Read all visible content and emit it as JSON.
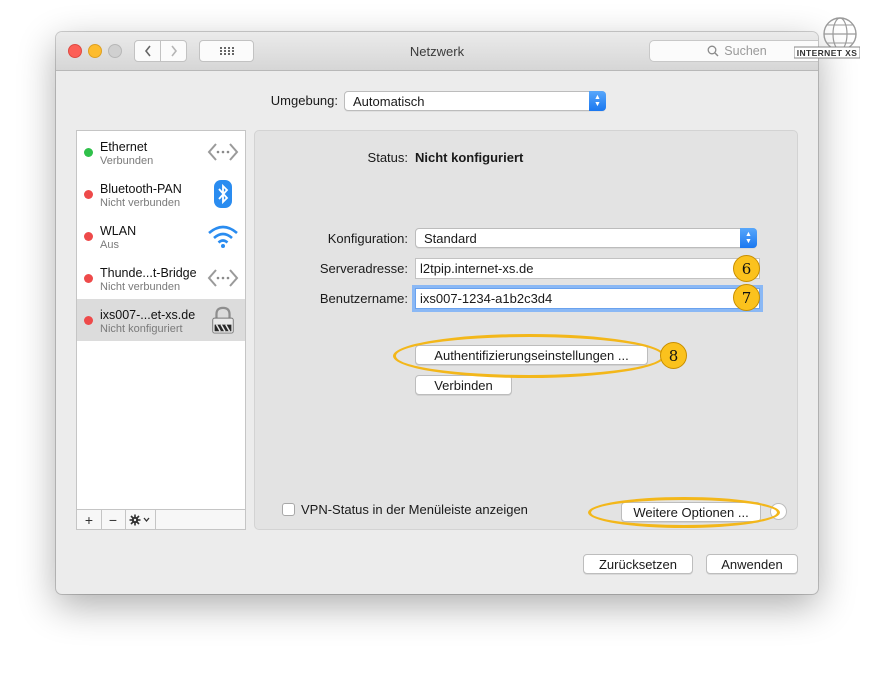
{
  "window": {
    "title": "Netzwerk",
    "search_placeholder": "Suchen"
  },
  "location": {
    "label": "Umgebung:",
    "value": "Automatisch"
  },
  "services": [
    {
      "name": "Ethernet",
      "status": "Verbunden",
      "state_color": "#2fc04a",
      "icon": "ethernet-icon"
    },
    {
      "name": "Bluetooth-PAN",
      "status": "Nicht verbunden",
      "state_color": "#ee4a4a",
      "icon": "bluetooth-icon"
    },
    {
      "name": "WLAN",
      "status": "Aus",
      "state_color": "#ee4a4a",
      "icon": "wifi-icon"
    },
    {
      "name": "Thunde...t-Bridge",
      "status": "Nicht verbunden",
      "state_color": "#ee4a4a",
      "icon": "thunderbolt-bridge-icon"
    },
    {
      "name": "ixs007-...et-xs.de",
      "status": "Nicht konfiguriert",
      "state_color": "#ee4a4a",
      "icon": "vpn-lock-icon",
      "selected": true
    }
  ],
  "sidebar_buttons": {
    "add": "+",
    "remove": "−"
  },
  "detail": {
    "status_label": "Status:",
    "status_value": "Nicht konfiguriert",
    "config_label": "Konfiguration:",
    "config_value": "Standard",
    "server_label": "Serveradresse:",
    "server_value": "l2tpip.internet-xs.de",
    "user_label": "Benutzername:",
    "user_value": "ixs007-1234-a1b2c3d4",
    "auth_button": "Authentifizierungseinstellungen ...",
    "connect_button": "Verbinden",
    "vpn_status_checkbox": "VPN-Status in der Menüleiste anzeigen",
    "advanced_button": "Weitere Optionen ..."
  },
  "footer": {
    "reset_button": "Zurücksetzen",
    "apply_button": "Anwenden"
  },
  "annotations": {
    "badge_6": "6",
    "badge_7": "7",
    "badge_8": "8",
    "highlight_color": "#f3b71a"
  },
  "watermark": {
    "text": "INTERNET XS"
  }
}
